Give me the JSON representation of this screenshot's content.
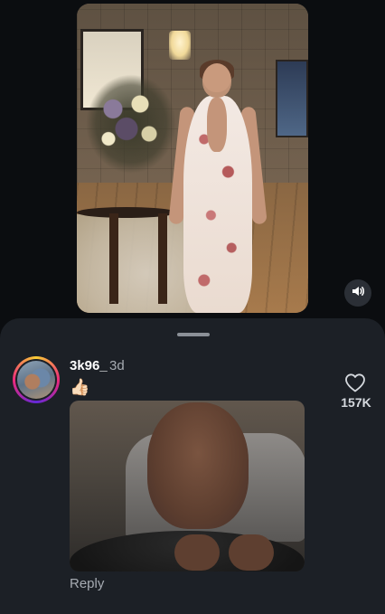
{
  "post": {
    "image_alt": "",
    "sound_icon": "speaker-icon"
  },
  "comment": {
    "username": "3k96_",
    "time": "3d",
    "text": "👍🏻",
    "like_count": "157K",
    "like_icon": "heart-outline-icon",
    "reply_label": "Reply"
  },
  "colors": {
    "background": "#0b0d10",
    "sheet": "#1c2026",
    "secondary_text": "#a6abb2",
    "story_ring": [
      "#f9ce34",
      "#ee2a7b",
      "#6228d7"
    ]
  }
}
